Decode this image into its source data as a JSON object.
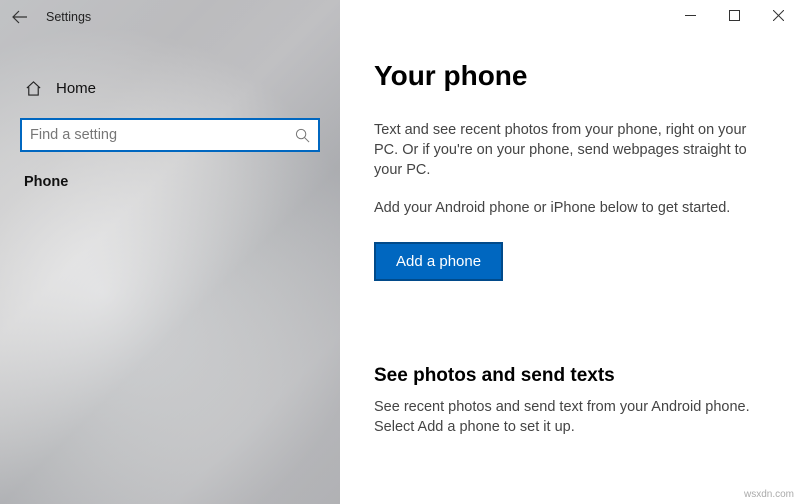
{
  "window": {
    "title": "Settings"
  },
  "sidebar": {
    "home_label": "Home",
    "search_placeholder": "Find a setting",
    "category": "Phone"
  },
  "main": {
    "title": "Your phone",
    "description1": "Text and see recent photos from your phone, right on your PC. Or if you're on your phone, send webpages straight to your PC.",
    "description2": "Add your Android phone or iPhone below to get started.",
    "add_button": "Add a phone",
    "section_heading": "See photos and send texts",
    "section_body": "See recent photos and send text from your Android phone. Select Add a phone to set it up."
  },
  "watermark": "wsxdn.com"
}
